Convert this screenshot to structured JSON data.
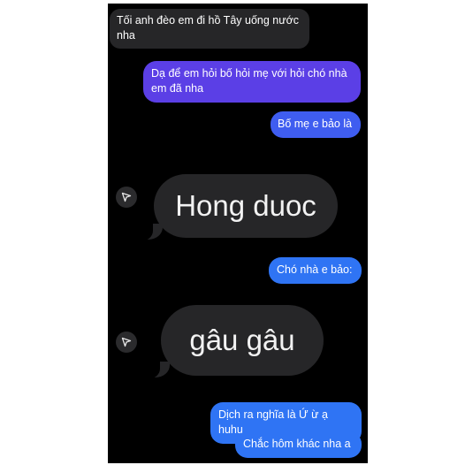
{
  "messages": [
    {
      "id": "msg1",
      "side": "received",
      "color": "#262628",
      "text": "Tối anh đèo em đi hồ Tây uống nước nha"
    },
    {
      "id": "msg2",
      "side": "sent",
      "color": "#5b3fe6",
      "text": "Dạ để em hỏi bố hỏi mẹ với hỏi chó nhà em đã nha"
    },
    {
      "id": "msg3",
      "side": "sent",
      "color": "#3f5df0",
      "text": "Bố mẹ e bảo là"
    },
    {
      "id": "msg4",
      "side": "received",
      "color": "#262628",
      "text": "Hong duoc"
    },
    {
      "id": "msg5",
      "side": "sent",
      "color": "#2f74f4",
      "text": "Chó nhà e bảo:"
    },
    {
      "id": "msg6",
      "side": "received",
      "color": "#262628",
      "text": "gâu gâu"
    },
    {
      "id": "msg7",
      "side": "sent",
      "color": "#2f74f4",
      "text": "Dịch ra nghĩa là Ứ ừ ạ huhu"
    },
    {
      "id": "msg8",
      "side": "sent",
      "color": "#2f74f4",
      "text": "Chắc hôm khác nha a"
    }
  ],
  "icons": {
    "share": "share-icon"
  }
}
